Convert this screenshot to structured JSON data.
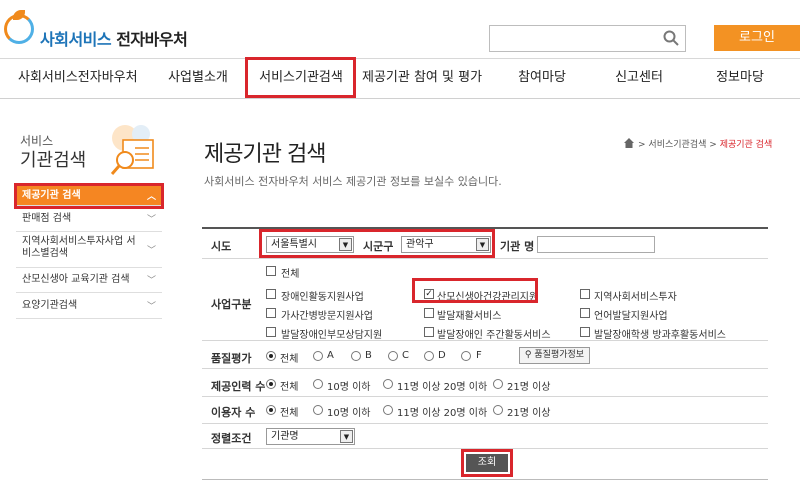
{
  "header": {
    "logo_main": "사회서비스",
    "logo_sub": "전자바우처",
    "login_label": "로그인"
  },
  "gnb": [
    "사회서비스전자바우처",
    "사업별소개",
    "서비스기관검색",
    "제공기관 참여 및 평가",
    "참여마당",
    "신고센터",
    "정보마당"
  ],
  "lnb": {
    "title_small": "서비스",
    "title_large": "기관검색",
    "items": [
      {
        "label": "제공기관 검색",
        "active": true
      },
      {
        "label": "판매점 검색"
      },
      {
        "label": "지역사회서비스투자사업 서비스별검색"
      },
      {
        "label": "산모신생아 교육기관 검색"
      },
      {
        "label": "요양기관검색"
      }
    ]
  },
  "content": {
    "title": "제공기관 검색",
    "description": "사회서비스 전자바우처 서비스 제공기관 정보를 보실수 있습니다.",
    "breadcrumb": {
      "sep": ">",
      "parent": "서비스기관검색",
      "current": "제공기관 검색"
    }
  },
  "form": {
    "sido_label": "시도",
    "sido_value": "서울특별시",
    "sigungu_label": "시군구",
    "sigungu_value": "관악구",
    "org_name_label": "기관 명",
    "biz_type_label": "사업구분",
    "biz_all": "전체",
    "biz_types": [
      "장애인활동지원사업",
      "산모신생아건강관리지원",
      "지역사회서비스투자",
      "가사간병방문지원사업",
      "발달재활서비스",
      "언어발달지원사업",
      "발달장애인부모상담지원",
      "발달장애인 주간활동서비스",
      "발달장애학생 방과후활동서비스"
    ],
    "biz_checked": "산모신생아건강관리지원",
    "quality_label": "품질평가",
    "quality_options": [
      "전체",
      "A",
      "B",
      "C",
      "D",
      "F"
    ],
    "quality_info_button": "품질평가정보",
    "staff_label": "제공인력 수",
    "staff_options": [
      "전체",
      "10명 이하",
      "11명 이상 20명 이하",
      "21명 이상"
    ],
    "user_label": "이용자 수",
    "user_options": [
      "전체",
      "10명 이하",
      "11명 이상 20명 이하",
      "21명 이상"
    ],
    "sort_label": "정렬조건",
    "sort_value": "기관명",
    "submit_label": "조회"
  }
}
